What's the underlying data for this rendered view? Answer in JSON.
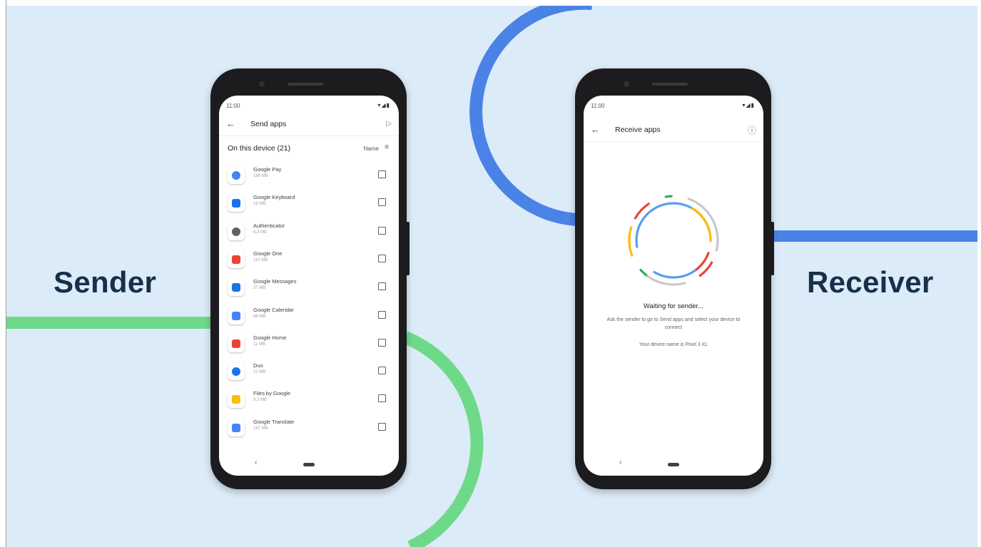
{
  "colors": {
    "background": "#dcebf8",
    "green_accent": "#6fd98a",
    "blue_accent": "#4a82e6",
    "label_text": "#17304a"
  },
  "labels": {
    "sender": "Sender",
    "receiver": "Receiver"
  },
  "sender_phone": {
    "status_time": "11:00",
    "status_icons": "▾◢▮",
    "back_icon": "←",
    "title": "Send apps",
    "send_icon": "▷",
    "section_title": "On this device (21)",
    "sort_label": "Name",
    "sort_icon": "≡",
    "apps": [
      {
        "name": "Google Pay",
        "size": "188 MB",
        "icon": "google-pay-icon",
        "color": "#4285f4"
      },
      {
        "name": "Google Keyboard",
        "size": "19 MB",
        "icon": "google-keyboard-icon",
        "color": "#1a73e8"
      },
      {
        "name": "Authenticator",
        "size": "8.3 MB",
        "icon": "authenticator-icon",
        "color": "#616161"
      },
      {
        "name": "Google One",
        "size": "110 MB",
        "icon": "google-one-icon",
        "color": "#ea4335"
      },
      {
        "name": "Google Messages",
        "size": "37 MB",
        "icon": "google-messages-icon",
        "color": "#1a73e8"
      },
      {
        "name": "Google Calendar",
        "size": "48 MB",
        "icon": "google-calendar-icon",
        "color": "#4285f4"
      },
      {
        "name": "Google Home",
        "size": "11 MB",
        "icon": "google-home-icon",
        "color": "#ea4335"
      },
      {
        "name": "Duo",
        "size": "21 MB",
        "icon": "duo-icon",
        "color": "#1a73e8"
      },
      {
        "name": "Files by Google",
        "size": "9.2 MB",
        "icon": "files-by-google-icon",
        "color": "#fbbc04"
      },
      {
        "name": "Google Translate",
        "size": "187 MB",
        "icon": "google-translate-icon",
        "color": "#4285f4"
      }
    ],
    "nav_back": "‹"
  },
  "receiver_phone": {
    "status_time": "11:00",
    "status_icons": "▾◢▮",
    "back_icon": "←",
    "title": "Receive apps",
    "info_icon": "ⓘ",
    "waiting_title": "Waiting for sender...",
    "waiting_description": "Ask the sender to go to Send apps and select your device to connect",
    "device_name_text": "Your device name is Pixel 3 XL",
    "nav_back": "‹"
  }
}
